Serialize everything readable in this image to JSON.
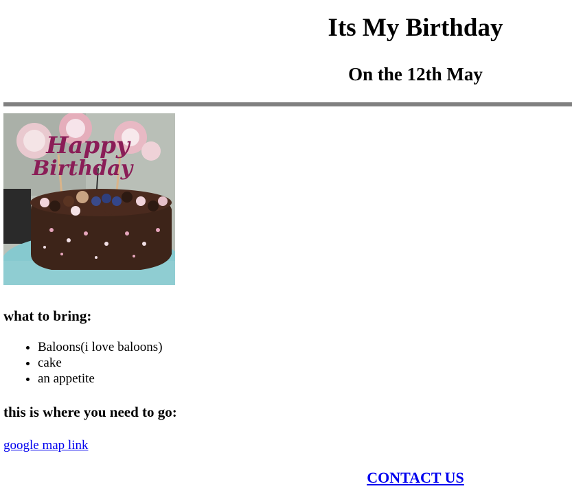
{
  "header": {
    "title": "Its My Birthday",
    "subtitle": "On the 12th May"
  },
  "image": {
    "icon": "birthday-cake-image",
    "topper_text": "Happy Birthday"
  },
  "bring": {
    "heading": "what to bring:",
    "items": [
      "Baloons(i love baloons)",
      "cake",
      "an appetite"
    ]
  },
  "location": {
    "heading": "this is where you need to go:",
    "link_label": "google map link"
  },
  "footer": {
    "contact_label": "CONTACT US"
  },
  "colors": {
    "rule": "#808080",
    "link": "#0000ee"
  }
}
